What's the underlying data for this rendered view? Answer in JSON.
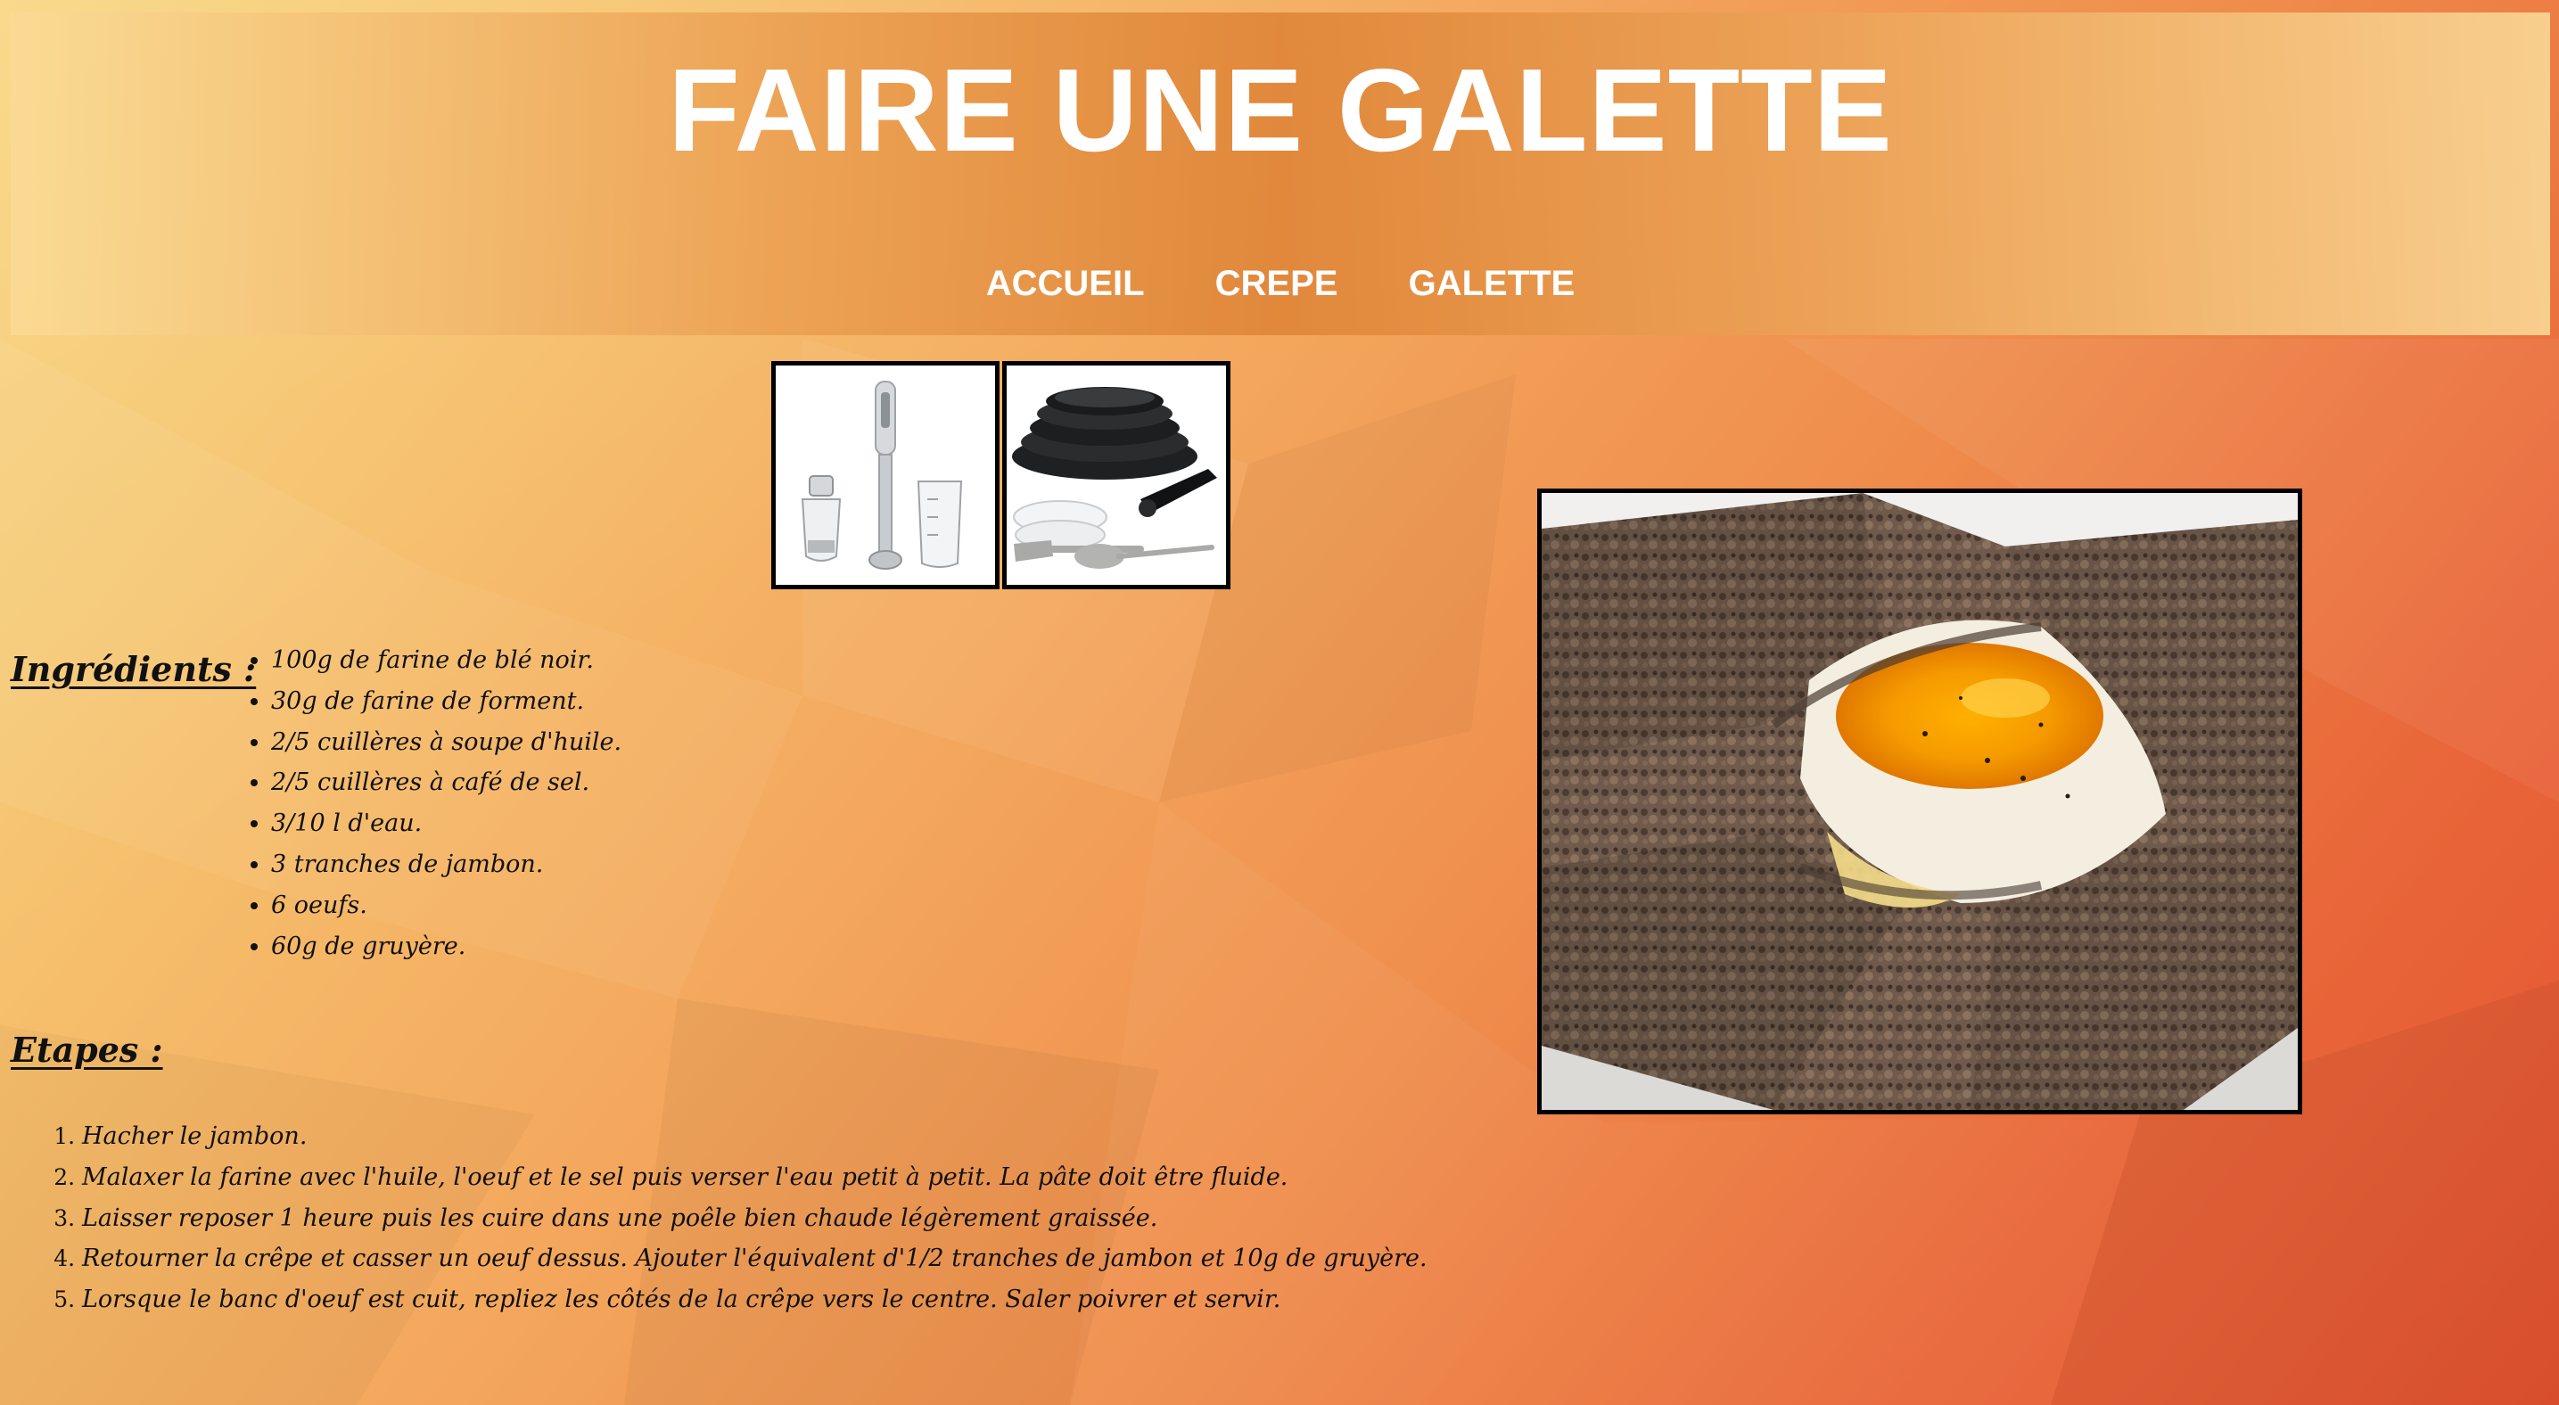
{
  "header": {
    "title": "FAIRE UNE GALETTE",
    "nav": [
      "ACCUEIL",
      "CREPE",
      "GALETTE"
    ]
  },
  "images": {
    "thumbnail_1": "hand-blender-set",
    "thumbnail_2": "cookware-pans-set",
    "main_photo": "buckwheat-galette-with-egg"
  },
  "ingredients": {
    "heading": "Ingrédients :",
    "items": [
      "100g de farine de blé noir.",
      "30g de farine de forment.",
      "2/5 cuillères à soupe d'huile.",
      "2/5 cuillères à café de sel.",
      "3/10 l d'eau.",
      "3 tranches de jambon.",
      "6 oeufs.",
      "60g de gruyère."
    ]
  },
  "etapes": {
    "heading": "Etapes :",
    "items": [
      "Hacher le jambon.",
      "Malaxer la farine avec l'huile, l'oeuf et le sel puis verser l'eau petit à petit. La pâte doit être fluide.",
      "Laisser reposer 1 heure puis les cuire dans une poêle bien chaude légèrement graissée.",
      "Retourner la crêpe et casser un oeuf dessus. Ajouter l'équivalent d'1/2 tranches de jambon et 10g de gruyère.",
      "Lorsque le banc d'oeuf est cuit, repliez les côtés de la crêpe vers le centre. Saler poivrer et servir."
    ]
  },
  "colors": {
    "background_start": "#f8d67f",
    "background_end": "#e45330",
    "header_center": "#df8538",
    "text": "#111111",
    "title": "#ffffff"
  }
}
